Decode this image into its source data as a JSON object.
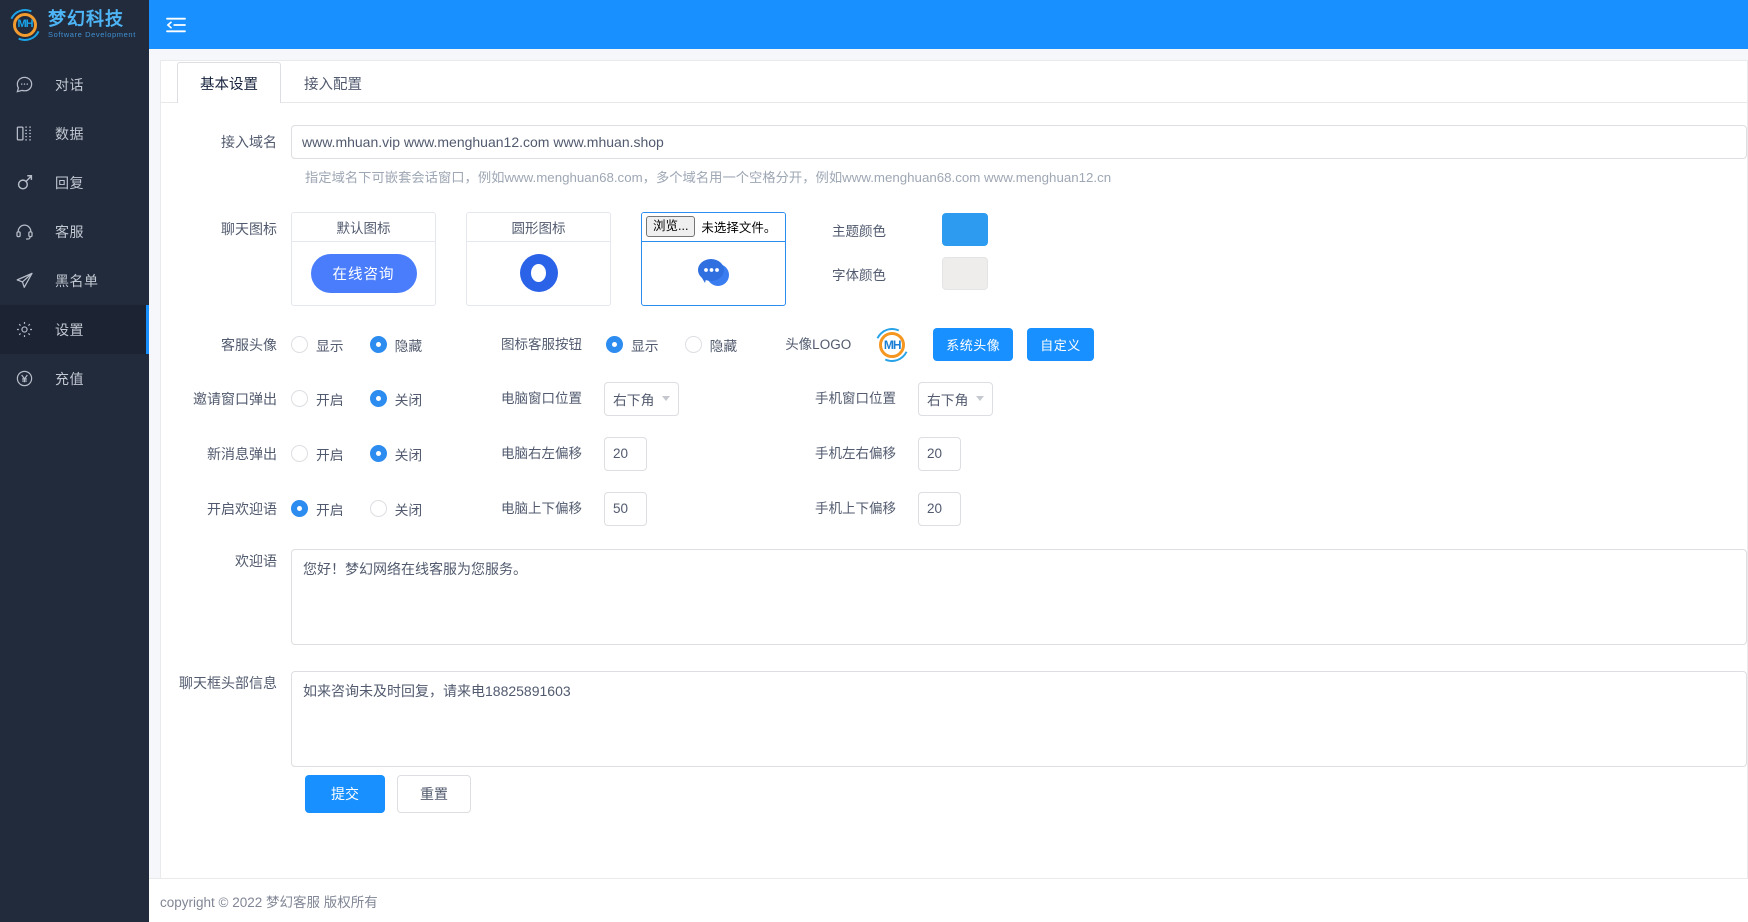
{
  "brand": {
    "name_cn": "梦幻科技",
    "name_en": "Software Development",
    "mark_text": "MH"
  },
  "sidebar": {
    "items": [
      {
        "label": "对话",
        "icon": "chat-icon",
        "active": false
      },
      {
        "label": "数据",
        "icon": "data-icon",
        "active": false
      },
      {
        "label": "回复",
        "icon": "reply-icon",
        "active": false
      },
      {
        "label": "客服",
        "icon": "headset-icon",
        "active": false
      },
      {
        "label": "黑名单",
        "icon": "send-icon",
        "active": false
      },
      {
        "label": "设置",
        "icon": "gear-icon",
        "active": true
      },
      {
        "label": "充值",
        "icon": "yuan-icon",
        "active": false
      }
    ]
  },
  "topbar": {
    "menu_toggle": "collapse-menu-icon"
  },
  "tabs": [
    {
      "label": "基本设置",
      "active": true
    },
    {
      "label": "接入配置",
      "active": false
    }
  ],
  "form": {
    "domain": {
      "label": "接入域名",
      "value": "www.mhuan.vip www.menghuan12.com www.mhuan.shop",
      "hint": "指定域名下可嵌套会话窗口，例如www.menghuan68.com，多个域名用一个空格分开，例如www.menghuan68.com www.menghuan12.cn"
    },
    "chat_icon": {
      "label": "聊天图标",
      "cards": [
        {
          "title": "默认图标",
          "type": "pill",
          "pill_text": "在线咨询",
          "selected": false
        },
        {
          "title": "圆形图标",
          "type": "ring",
          "selected": false
        },
        {
          "title": "",
          "type": "file",
          "browse_label": "浏览...",
          "file_status": "未选择文件。",
          "selected": true
        }
      ]
    },
    "colors": {
      "theme": {
        "label": "主题颜色",
        "value": "#2d9cf0"
      },
      "font": {
        "label": "字体颜色",
        "value": "#efedec"
      }
    },
    "avatar": {
      "label": "客服头像",
      "options": [
        {
          "label": "显示",
          "checked": false
        },
        {
          "label": "隐藏",
          "checked": true
        }
      ]
    },
    "icon_service_button": {
      "label": "图标客服按钮",
      "options": [
        {
          "label": "显示",
          "checked": true
        },
        {
          "label": "隐藏",
          "checked": false
        }
      ]
    },
    "avatar_logo": {
      "label": "头像LOGO",
      "logo_text": "MH",
      "buttons": [
        {
          "label": "系统头像"
        },
        {
          "label": "自定义"
        }
      ]
    },
    "invite_popup": {
      "label": "邀请窗口弹出",
      "options": [
        {
          "label": "开启",
          "checked": false
        },
        {
          "label": "关闭",
          "checked": true
        }
      ]
    },
    "new_msg_popup": {
      "label": "新消息弹出",
      "options": [
        {
          "label": "开启",
          "checked": false
        },
        {
          "label": "关闭",
          "checked": true
        }
      ]
    },
    "welcome_enable": {
      "label": "开启欢迎语",
      "options": [
        {
          "label": "开启",
          "checked": true
        },
        {
          "label": "关闭",
          "checked": false
        }
      ]
    },
    "pc_window_pos": {
      "label": "电脑窗口位置",
      "value": "右下角"
    },
    "pc_x_offset": {
      "label": "电脑右左偏移",
      "value": "20"
    },
    "pc_y_offset": {
      "label": "电脑上下偏移",
      "value": "50"
    },
    "mobile_window_pos": {
      "label": "手机窗口位置",
      "value": "右下角"
    },
    "mobile_x_offset": {
      "label": "手机左右偏移",
      "value": "20"
    },
    "mobile_y_offset": {
      "label": "手机上下偏移",
      "value": "20"
    },
    "welcome_text": {
      "label": "欢迎语",
      "value": "您好！梦幻网络在线客服为您服务。"
    },
    "chat_header_text": {
      "label": "聊天框头部信息",
      "value": "如来咨询未及时回复，请来电18825891603"
    },
    "actions": {
      "submit": "提交",
      "reset": "重置"
    }
  },
  "footer": {
    "text": "copyright © 2022 梦幻客服 版权所有"
  }
}
